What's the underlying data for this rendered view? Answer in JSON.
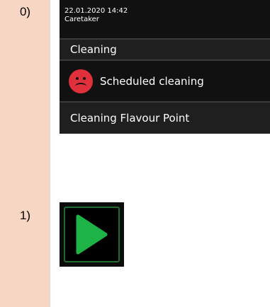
{
  "steps": [
    {
      "label": "0)"
    },
    {
      "label": "1)"
    }
  ],
  "screen": {
    "timestamp": "22.01.2020 14:42",
    "user": "Caretaker",
    "title": "Cleaning",
    "scheduled_label": "Scheduled cleaning",
    "scheduled_icon": "sad-face-icon",
    "flavour_label": "Cleaning Flavour Point"
  },
  "play": {
    "icon": "play-icon",
    "color": "#1db347"
  },
  "colors": {
    "step_column": "#f7d7c4",
    "panel_bg": "#111111",
    "row_bg": "#1f1f1f",
    "sad_icon": "#e0303b"
  }
}
